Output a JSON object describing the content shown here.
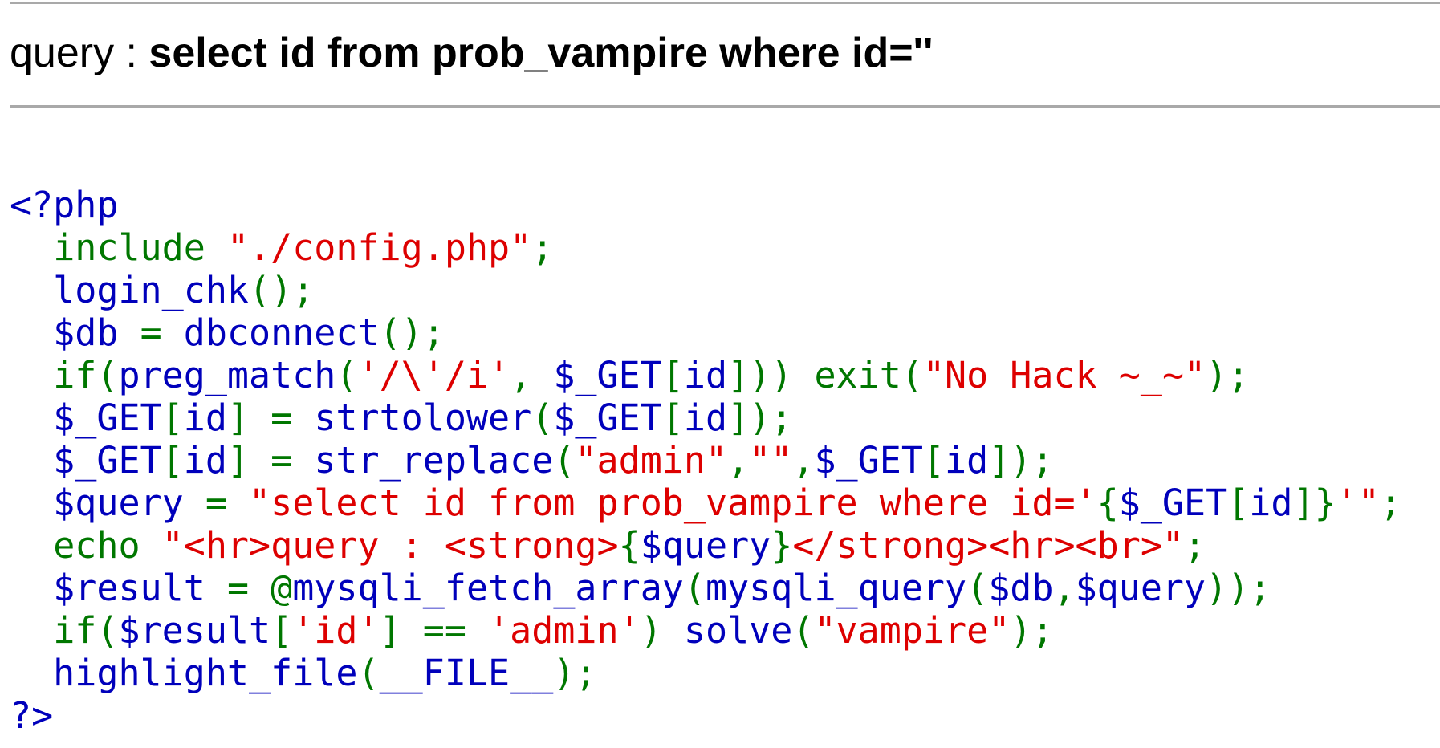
{
  "query_line": {
    "prefix": "query : ",
    "value": "select id from prob_vampire where id=''"
  },
  "source_code": {
    "lines": [
      [
        {
          "t": "<?php",
          "c": "d"
        }
      ],
      [
        {
          "t": "  ",
          "c": "d"
        },
        {
          "t": "include ",
          "c": "k"
        },
        {
          "t": "\"./config.php\"",
          "c": "s"
        },
        {
          "t": ";",
          "c": "k"
        }
      ],
      [
        {
          "t": "  login_chk",
          "c": "d"
        },
        {
          "t": "();",
          "c": "k"
        }
      ],
      [
        {
          "t": "  $db ",
          "c": "d"
        },
        {
          "t": "= ",
          "c": "k"
        },
        {
          "t": "dbconnect",
          "c": "d"
        },
        {
          "t": "();",
          "c": "k"
        }
      ],
      [
        {
          "t": "  ",
          "c": "d"
        },
        {
          "t": "if(",
          "c": "k"
        },
        {
          "t": "preg_match",
          "c": "d"
        },
        {
          "t": "(",
          "c": "k"
        },
        {
          "t": "'/\\'/i'",
          "c": "s"
        },
        {
          "t": ", ",
          "c": "k"
        },
        {
          "t": "$_GET",
          "c": "d"
        },
        {
          "t": "[",
          "c": "k"
        },
        {
          "t": "id",
          "c": "d"
        },
        {
          "t": "])) ",
          "c": "k"
        },
        {
          "t": "exit(",
          "c": "k"
        },
        {
          "t": "\"No Hack ~_~\"",
          "c": "s"
        },
        {
          "t": ");",
          "c": "k"
        }
      ],
      [
        {
          "t": "  $_GET",
          "c": "d"
        },
        {
          "t": "[",
          "c": "k"
        },
        {
          "t": "id",
          "c": "d"
        },
        {
          "t": "] = ",
          "c": "k"
        },
        {
          "t": "strtolower",
          "c": "d"
        },
        {
          "t": "(",
          "c": "k"
        },
        {
          "t": "$_GET",
          "c": "d"
        },
        {
          "t": "[",
          "c": "k"
        },
        {
          "t": "id",
          "c": "d"
        },
        {
          "t": "]);",
          "c": "k"
        }
      ],
      [
        {
          "t": "  $_GET",
          "c": "d"
        },
        {
          "t": "[",
          "c": "k"
        },
        {
          "t": "id",
          "c": "d"
        },
        {
          "t": "] = ",
          "c": "k"
        },
        {
          "t": "str_replace",
          "c": "d"
        },
        {
          "t": "(",
          "c": "k"
        },
        {
          "t": "\"admin\"",
          "c": "s"
        },
        {
          "t": ",",
          "c": "k"
        },
        {
          "t": "\"\"",
          "c": "s"
        },
        {
          "t": ",",
          "c": "k"
        },
        {
          "t": "$_GET",
          "c": "d"
        },
        {
          "t": "[",
          "c": "k"
        },
        {
          "t": "id",
          "c": "d"
        },
        {
          "t": "]);",
          "c": "k"
        }
      ],
      [
        {
          "t": "  $query ",
          "c": "d"
        },
        {
          "t": "= ",
          "c": "k"
        },
        {
          "t": "\"select id from prob_vampire where id='",
          "c": "s"
        },
        {
          "t": "{",
          "c": "k"
        },
        {
          "t": "$_GET",
          "c": "d"
        },
        {
          "t": "[",
          "c": "k"
        },
        {
          "t": "id",
          "c": "d"
        },
        {
          "t": "]}",
          "c": "k"
        },
        {
          "t": "'\"",
          "c": "s"
        },
        {
          "t": ";",
          "c": "k"
        }
      ],
      [
        {
          "t": "  ",
          "c": "d"
        },
        {
          "t": "echo ",
          "c": "k"
        },
        {
          "t": "\"<hr>query : <strong>",
          "c": "s"
        },
        {
          "t": "{",
          "c": "k"
        },
        {
          "t": "$query",
          "c": "d"
        },
        {
          "t": "}",
          "c": "k"
        },
        {
          "t": "</strong><hr><br>\"",
          "c": "s"
        },
        {
          "t": ";",
          "c": "k"
        }
      ],
      [
        {
          "t": "  $result ",
          "c": "d"
        },
        {
          "t": "= @",
          "c": "k"
        },
        {
          "t": "mysqli_fetch_array",
          "c": "d"
        },
        {
          "t": "(",
          "c": "k"
        },
        {
          "t": "mysqli_query",
          "c": "d"
        },
        {
          "t": "(",
          "c": "k"
        },
        {
          "t": "$db",
          "c": "d"
        },
        {
          "t": ",",
          "c": "k"
        },
        {
          "t": "$query",
          "c": "d"
        },
        {
          "t": "));",
          "c": "k"
        }
      ],
      [
        {
          "t": "  ",
          "c": "d"
        },
        {
          "t": "if(",
          "c": "k"
        },
        {
          "t": "$result",
          "c": "d"
        },
        {
          "t": "[",
          "c": "k"
        },
        {
          "t": "'id'",
          "c": "s"
        },
        {
          "t": "] == ",
          "c": "k"
        },
        {
          "t": "'admin'",
          "c": "s"
        },
        {
          "t": ") ",
          "c": "k"
        },
        {
          "t": "solve",
          "c": "d"
        },
        {
          "t": "(",
          "c": "k"
        },
        {
          "t": "\"vampire\"",
          "c": "s"
        },
        {
          "t": ");",
          "c": "k"
        }
      ],
      [
        {
          "t": "  highlight_file",
          "c": "d"
        },
        {
          "t": "(",
          "c": "k"
        },
        {
          "t": "__FILE__",
          "c": "d"
        },
        {
          "t": ");",
          "c": "k"
        }
      ],
      [
        {
          "t": "?>",
          "c": "d"
        }
      ]
    ]
  }
}
